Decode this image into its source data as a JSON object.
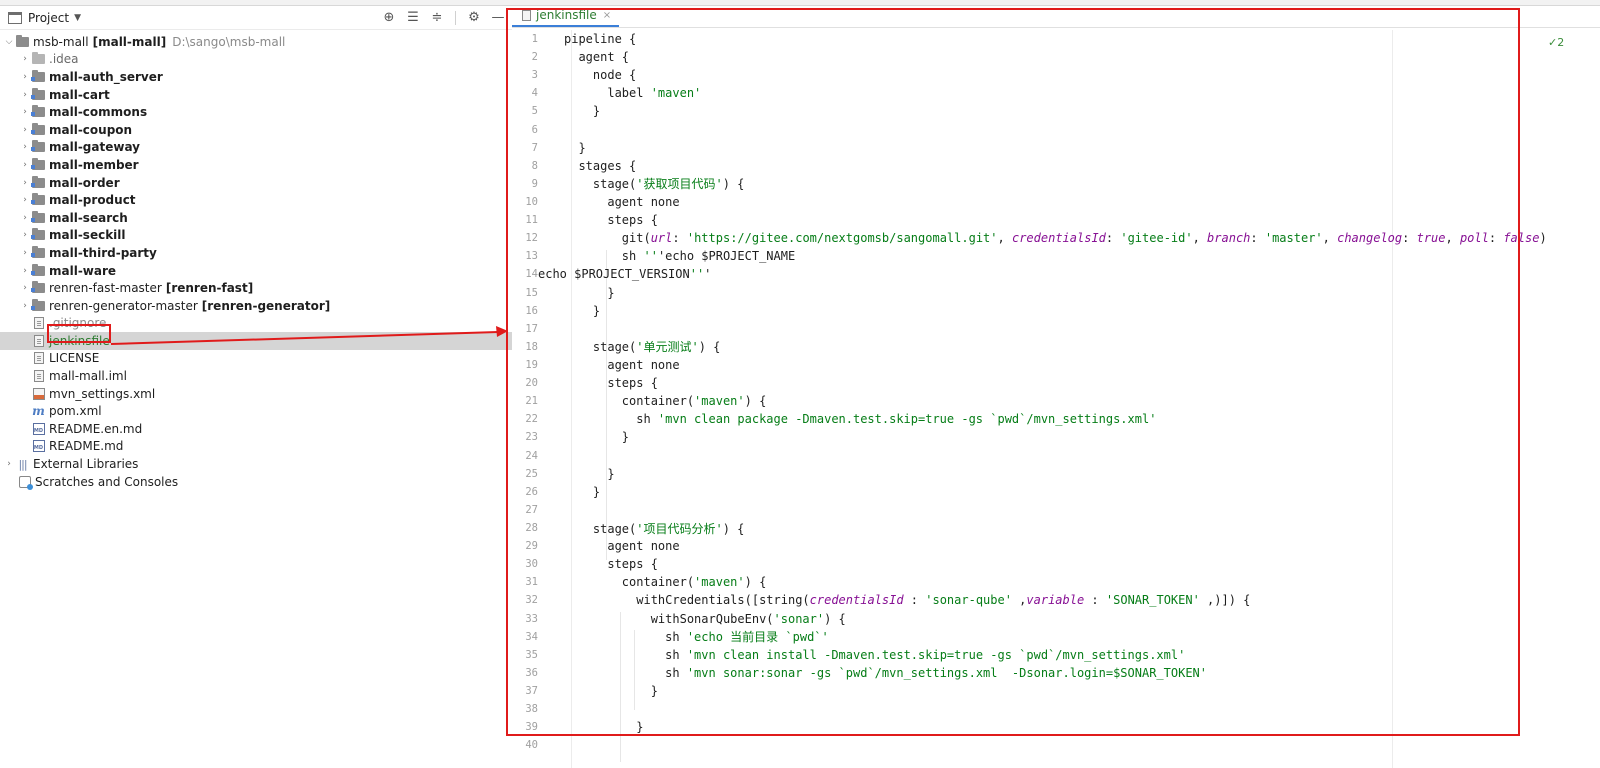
{
  "project_panel": {
    "title": "Project",
    "tree": [
      {
        "name": "msb-mall",
        "suffix": "[mall-mall]",
        "path": "D:\\sango\\msb-mall",
        "expanded": true
      },
      {
        "name": ".idea",
        "muted": true
      },
      {
        "name": "mall-auth_server"
      },
      {
        "name": "mall-cart"
      },
      {
        "name": "mall-commons"
      },
      {
        "name": "mall-coupon"
      },
      {
        "name": "mall-gateway"
      },
      {
        "name": "mall-member"
      },
      {
        "name": "mall-order"
      },
      {
        "name": "mall-product"
      },
      {
        "name": "mall-search"
      },
      {
        "name": "mall-seckill"
      },
      {
        "name": "mall-third-party"
      },
      {
        "name": "mall-ware"
      },
      {
        "name": "renren-fast-master",
        "suffix": "[renren-fast]"
      },
      {
        "name": "renren-generator-master",
        "suffix": "[renren-generator]"
      },
      {
        "name": ".gitignore",
        "muted": true
      },
      {
        "name": "jenkinsfile",
        "selected": true
      },
      {
        "name": "LICENSE"
      },
      {
        "name": "mall-mall.iml"
      },
      {
        "name": "mvn_settings.xml"
      },
      {
        "name": "pom.xml"
      },
      {
        "name": "README.en.md"
      },
      {
        "name": "README.md"
      },
      {
        "name": "External Libraries"
      },
      {
        "name": "Scratches and Consoles"
      }
    ]
  },
  "editor": {
    "tab": {
      "label": "jenkinsfile",
      "close": "×"
    },
    "right_indicator": "✓2",
    "lines": [
      {
        "n": "1",
        "t": "pipeline {"
      },
      {
        "n": "2",
        "t": "  agent {"
      },
      {
        "n": "3",
        "t": "    node {"
      },
      {
        "n": "4",
        "t": "      label 'maven'"
      },
      {
        "n": "5",
        "t": "    }"
      },
      {
        "n": "6",
        "t": ""
      },
      {
        "n": "7",
        "t": "  }"
      },
      {
        "n": "8",
        "t": "  stages {"
      },
      {
        "n": "9",
        "t": "    stage('获取项目代码') {"
      },
      {
        "n": "10",
        "t": "      agent none"
      },
      {
        "n": "11",
        "t": "      steps {"
      },
      {
        "n": "12",
        "t": "        git(url: 'https://gitee.com/nextgomsb/sangomall.git', credentialsId: 'gitee-id', branch: 'master', changelog: true, poll: false)"
      },
      {
        "n": "13",
        "t": "        sh '''echo $PROJECT_NAME"
      },
      {
        "n": "14",
        "t": "echo $PROJECT_VERSION'''"
      },
      {
        "n": "15",
        "t": "      }"
      },
      {
        "n": "16",
        "t": "    }"
      },
      {
        "n": "17",
        "t": ""
      },
      {
        "n": "18",
        "t": "    stage('单元测试') {"
      },
      {
        "n": "19",
        "t": "      agent none"
      },
      {
        "n": "20",
        "t": "      steps {"
      },
      {
        "n": "21",
        "t": "        container('maven') {"
      },
      {
        "n": "22",
        "t": "          sh 'mvn clean package -Dmaven.test.skip=true -gs `pwd`/mvn_settings.xml'"
      },
      {
        "n": "23",
        "t": "        }"
      },
      {
        "n": "24",
        "t": ""
      },
      {
        "n": "25",
        "t": "      }"
      },
      {
        "n": "26",
        "t": "    }"
      },
      {
        "n": "27",
        "t": ""
      },
      {
        "n": "28",
        "t": "    stage('项目代码分析') {"
      },
      {
        "n": "29",
        "t": "      agent none"
      },
      {
        "n": "30",
        "t": "      steps {"
      },
      {
        "n": "31",
        "t": "        container('maven') {"
      },
      {
        "n": "32",
        "t": "          withCredentials([string(credentialsId : 'sonar-qube' ,variable : 'SONAR_TOKEN' ,)]) {"
      },
      {
        "n": "33",
        "t": "            withSonarQubeEnv('sonar') {"
      },
      {
        "n": "34",
        "t": "              sh 'echo 当前目录 `pwd`'"
      },
      {
        "n": "35",
        "t": "              sh 'mvn clean install -Dmaven.test.skip=true -gs `pwd`/mvn_settings.xml'"
      },
      {
        "n": "36",
        "t": "              sh 'mvn sonar:sonar -gs `pwd`/mvn_settings.xml  -Dsonar.login=$SONAR_TOKEN'"
      },
      {
        "n": "37",
        "t": "            }"
      },
      {
        "n": "38",
        "t": ""
      },
      {
        "n": "39",
        "t": "          }"
      },
      {
        "n": "40",
        "t": ""
      }
    ]
  }
}
